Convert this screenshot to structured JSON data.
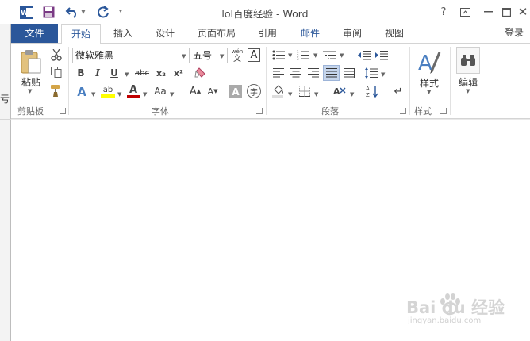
{
  "app": {
    "title": "lol百度经验 - Word"
  },
  "background_window": {
    "fragment": "亏"
  },
  "tabs": [
    {
      "id": "file",
      "label": "文件"
    },
    {
      "id": "home",
      "label": "开始"
    },
    {
      "id": "insert",
      "label": "插入"
    },
    {
      "id": "design",
      "label": "设计"
    },
    {
      "id": "layout",
      "label": "页面布局"
    },
    {
      "id": "references",
      "label": "引用"
    },
    {
      "id": "mailings",
      "label": "邮件"
    },
    {
      "id": "review",
      "label": "审阅"
    },
    {
      "id": "view",
      "label": "视图"
    }
  ],
  "login": "登录",
  "clipboard": {
    "paste_label": "粘贴",
    "group_label": "剪贴板"
  },
  "font": {
    "font_name": "微软雅黑",
    "font_size": "五号",
    "phonetic_top": "wén",
    "phonetic_bottom": "文",
    "border_glyph": "A",
    "bold": "B",
    "italic": "I",
    "underline": "U",
    "strike": "abc",
    "subscript": "x₂",
    "superscript": "x²",
    "effects": "A",
    "highlight": "ab",
    "font_color": "A",
    "change_case": "Aa",
    "grow": "A",
    "shrink": "A",
    "shade": "A",
    "enclose": "字",
    "group_label": "字体"
  },
  "paragraph": {
    "group_label": "段落"
  },
  "styles": {
    "label": "样式",
    "group_label": "样式"
  },
  "editing": {
    "label": "编辑"
  },
  "watermark": {
    "brand": "Bai du 经验",
    "url": "jingyan.baidu.com"
  },
  "colors": {
    "accent": "#2b579a",
    "highlight": "#ffff00",
    "font_red": "#c00000"
  }
}
